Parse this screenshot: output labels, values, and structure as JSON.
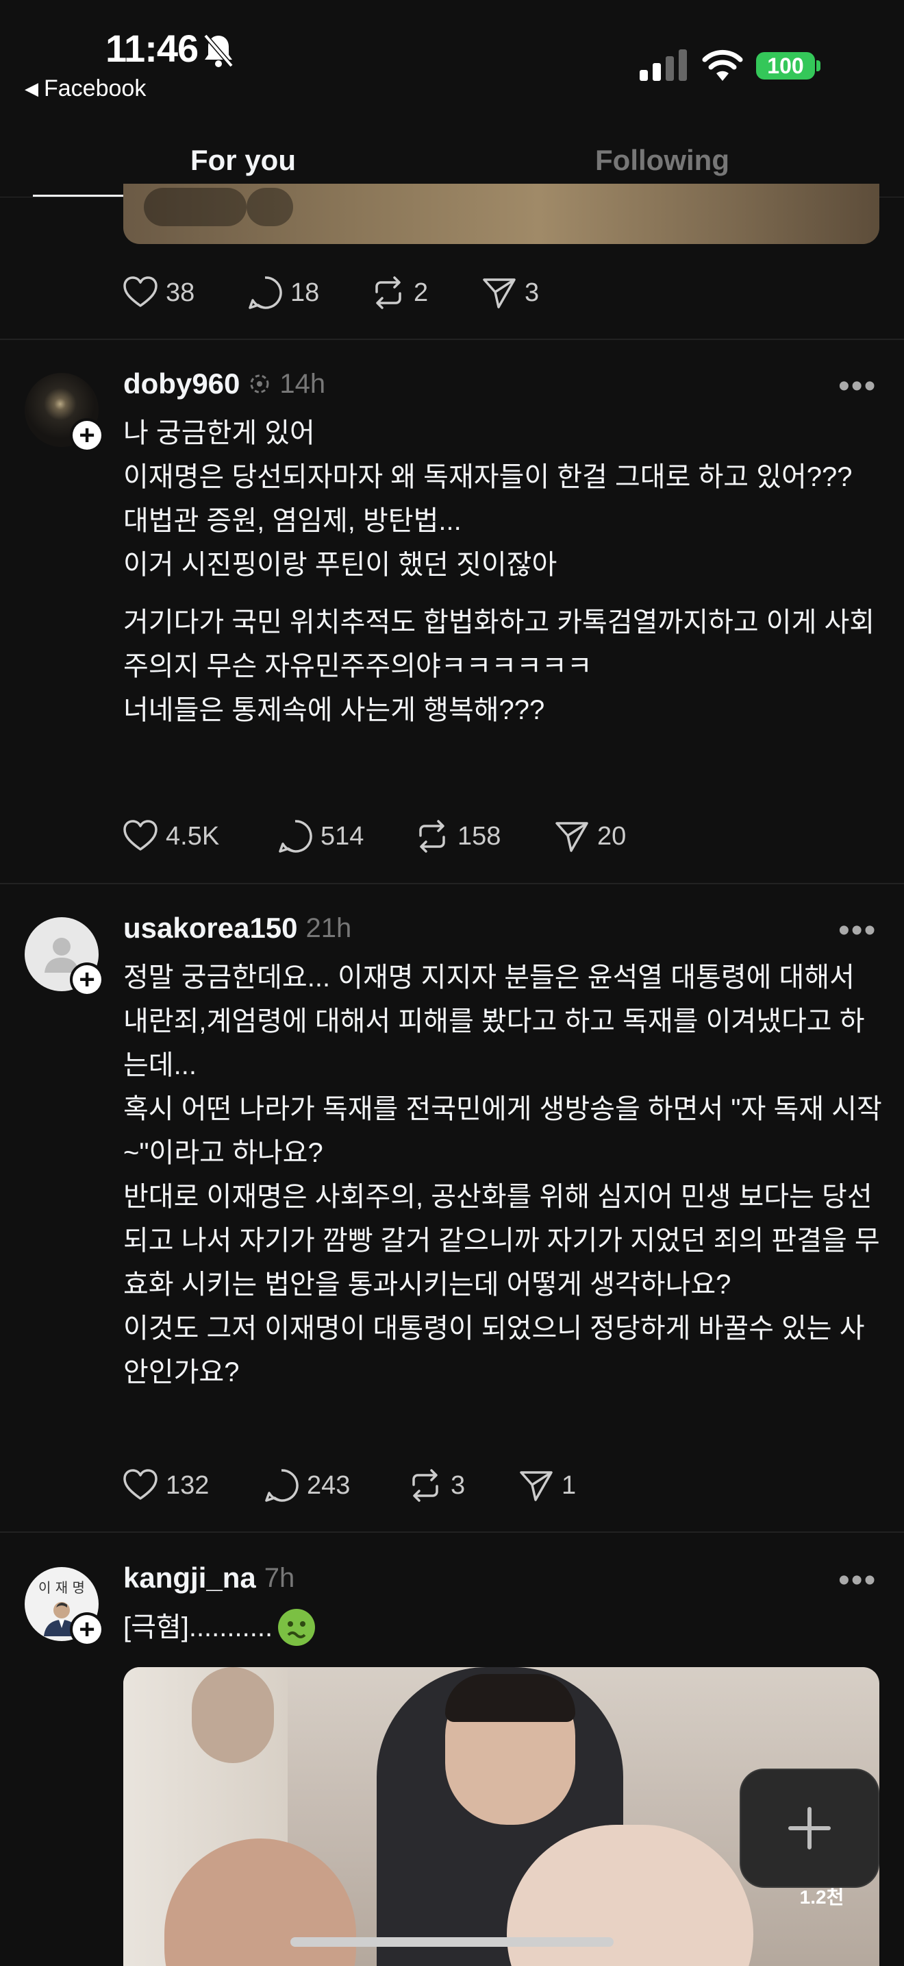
{
  "status_bar": {
    "time": "11:46",
    "back_app": "Facebook",
    "battery": "100"
  },
  "tabs": [
    {
      "label": "For you",
      "active": true
    },
    {
      "label": "Following",
      "active": false
    }
  ],
  "top_post_actions": {
    "likes": "38",
    "replies": "18",
    "reposts": "2",
    "shares": "3"
  },
  "posts": [
    {
      "username": "doby960",
      "time": "14h",
      "lines": [
        "나 궁금한게 있어",
        "이재명은 당선되자마자 왜 독재자들이 한걸 그대로 하고 있어???",
        "대법관 증원, 염임제, 방탄법...",
        "이거 시진핑이랑 푸틴이 했던 짓이잖아",
        "거기다가 국민 위치추적도 합법화하고 카톡검열까지하고 이게 사회주의지 무슨 자유민주주의야ㅋㅋㅋㅋㅋㅋ",
        "너네들은 통제속에 사는게 행복해???"
      ],
      "likes": "4.5K",
      "replies": "514",
      "reposts": "158",
      "shares": "20"
    },
    {
      "username": "usakorea150",
      "time": "21h",
      "lines": [
        "정말 궁금한데요... 이재명 지지자 분들은 윤석열 대통령에 대해서 내란죄,계엄령에 대해서 피해를 봤다고 하고 독재를 이겨냈다고 하는데...",
        "혹시 어떤 나라가 독재를 전국민에게 생방송을 하면서 \"자 독재 시작~\"이라고 하나요?",
        "반대로 이재명은 사회주의, 공산화를 위해 심지어 민생 보다는 당선 되고 나서 자기가 깜빵 갈거 같으니까 자기가 지었던 죄의 판결을 무효화 시키는 법안을 통과시키는데 어떻게 생각하나요?",
        "이것도 그저 이재명이 대통령이 되었으니 정당하게 바꿀수 있는 사안인가요?"
      ],
      "likes": "132",
      "replies": "243",
      "reposts": "3",
      "shares": "1"
    },
    {
      "username": "kangji_na",
      "time": "7h",
      "text": "[극혐]...........",
      "emoji": "🤢",
      "avatar_text": "이 재 명"
    }
  ],
  "media_overlay": {
    "count": "1.2천"
  },
  "colors": {
    "background": "#101010",
    "text": "#f3f5f7",
    "muted": "#777777",
    "battery": "#34c759"
  }
}
